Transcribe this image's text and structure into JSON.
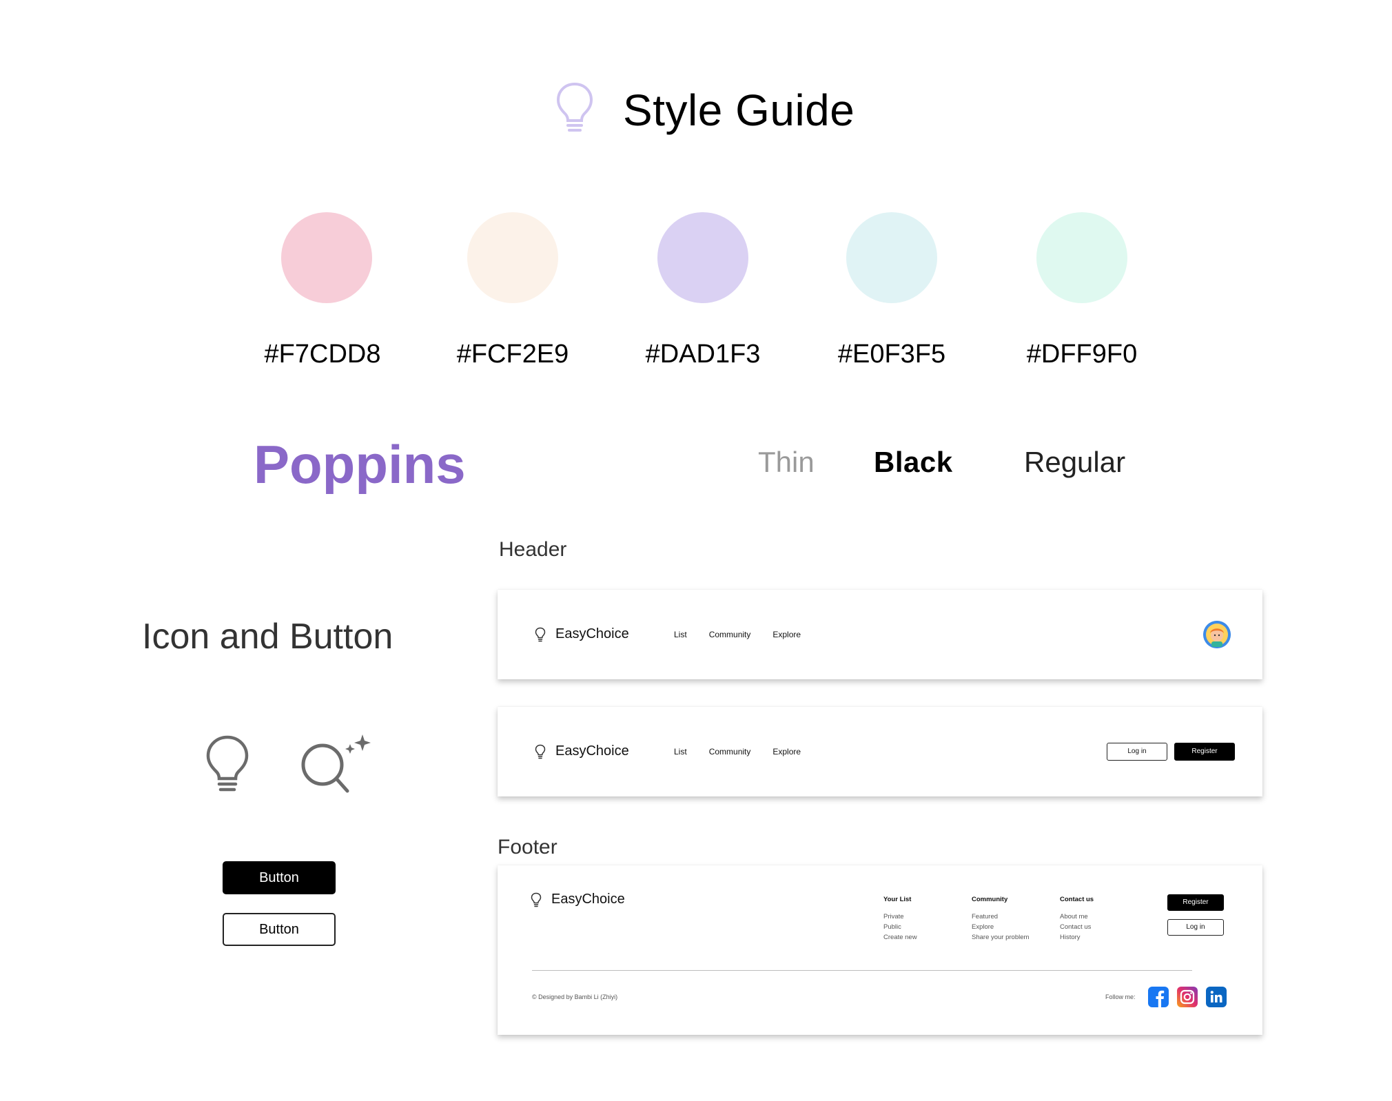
{
  "title": "Style Guide",
  "palette": [
    {
      "hex_label": "#F7CDD8",
      "color": "#F7CDD8"
    },
    {
      "hex_label": "#FCF2E9",
      "color": "#FCF2E9"
    },
    {
      "hex_label": "#DAD1F3",
      "color": "#DAD1F3"
    },
    {
      "hex_label": "#E0F3F5",
      "color": "#E0F3F5"
    },
    {
      "hex_label": "#DFF9F0",
      "color": "#DFF9F0"
    }
  ],
  "typography": {
    "font_name": "Poppins",
    "font_name_color": "#8A68C8",
    "weights": [
      "Thin",
      "Black",
      "Regular"
    ]
  },
  "sections": {
    "icon_and_button": "Icon and Button",
    "header": "Header",
    "footer": "Footer"
  },
  "icons": [
    "lightbulb-icon",
    "magic-search-icon"
  ],
  "demo_buttons": {
    "filled_label": "Button",
    "outline_label": "Button"
  },
  "header_logged_in": {
    "logo": "EasyChoice",
    "nav": [
      "List",
      "Community",
      "Explore"
    ],
    "avatar": "avatar"
  },
  "header_logged_out": {
    "logo": "EasyChoice",
    "nav": [
      "List",
      "Community",
      "Explore"
    ],
    "login_label": "Log in",
    "register_label": "Register"
  },
  "footer": {
    "logo": "EasyChoice",
    "columns": [
      {
        "heading": "Your List",
        "links": [
          "Private",
          "Public",
          "Create new"
        ]
      },
      {
        "heading": "Community",
        "links": [
          "Featured",
          "Explore",
          "Share your problem"
        ]
      },
      {
        "heading": "Contact us",
        "links": [
          "About me",
          "Contact us",
          "History"
        ]
      }
    ],
    "register_label": "Register",
    "login_label": "Log in",
    "credit": "© Designed by Bambi Li (Zhiyi)",
    "follow_label": "Follow me:",
    "socials": [
      "facebook-icon",
      "instagram-icon",
      "linkedin-icon"
    ]
  }
}
